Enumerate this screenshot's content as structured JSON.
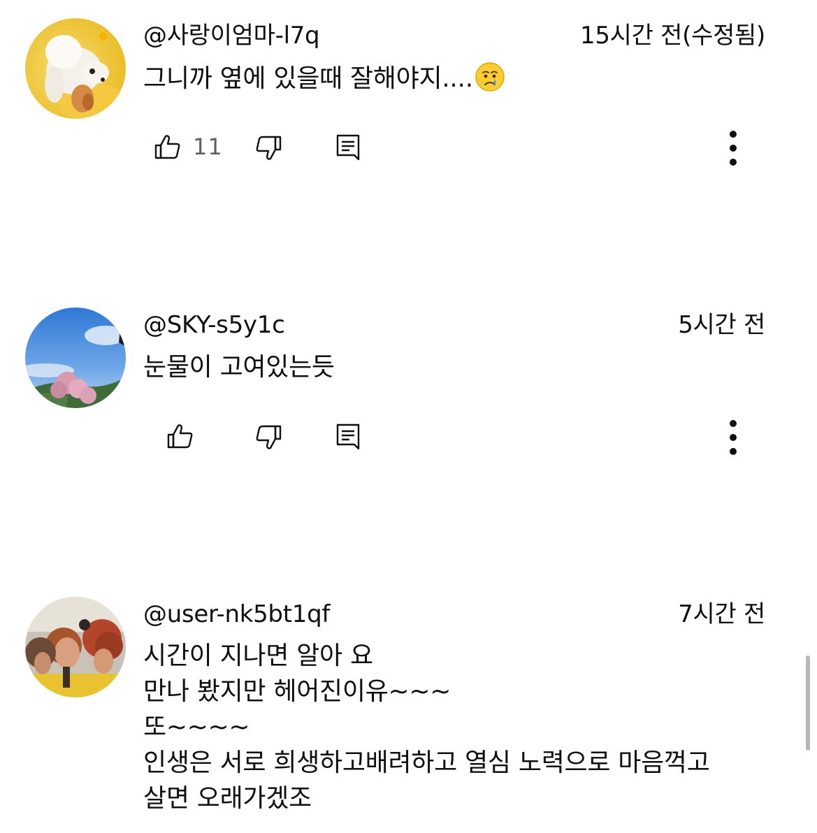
{
  "comments": [
    {
      "author": "@사랑이엄마-l7q",
      "timestamp": "15시간 전(수정됨)",
      "lines": [
        "그니까 옆에 있을때 잘해야지...."
      ],
      "emoji": "crying-face",
      "like_count": "11"
    },
    {
      "author": "@SKY-s5y1c",
      "timestamp": "5시간 전",
      "lines": [
        "눈물이 고여있는듯"
      ],
      "like_count": ""
    },
    {
      "author": "@user-nk5bt1qf",
      "timestamp": "7시간 전",
      "lines": [
        "시간이 지나면 알아 요",
        "만나 봤지만 헤어진이유~~~",
        "또~~~~",
        "인생은 서로 희생하고배려하고 열심 노력으로 마음꺽고",
        "살면 오래가겠조"
      ]
    }
  ],
  "icons": {
    "like": "thumbs-up-icon",
    "dislike": "thumbs-down-icon",
    "reply": "comment-icon",
    "menu": "more-vert-icon"
  },
  "colors": {
    "text": "#0f0f0f",
    "secondary_text": "#606060",
    "icon": "#0f0f0f",
    "background": "#ffffff"
  }
}
